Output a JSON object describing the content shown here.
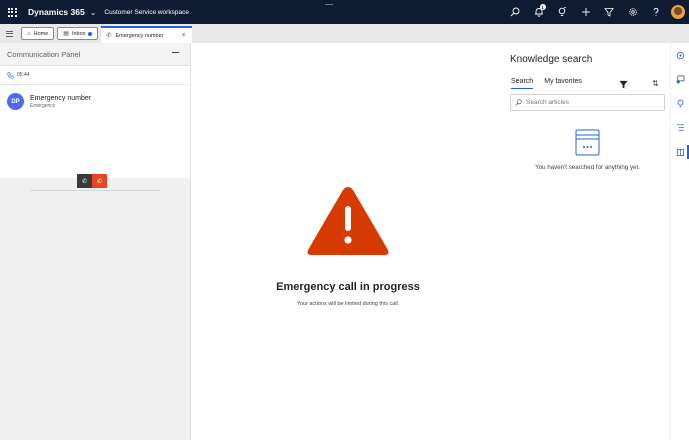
{
  "topbar": {
    "brand": "Dynamics 365",
    "workspace": "Customer Service workspace",
    "notification_count": "1",
    "icons": [
      "search-icon",
      "bell-icon",
      "lightbulb-icon",
      "plus-icon",
      "filter-icon",
      "gear-icon",
      "help-icon",
      "avatar"
    ]
  },
  "tabs": [
    {
      "label": "Home",
      "icon": "home-icon"
    },
    {
      "label": "Inbox",
      "icon": "inbox-icon"
    },
    {
      "label": "Emergency number",
      "icon": "phone-icon",
      "active": true
    }
  ],
  "comm_panel": {
    "title": "Communication Panel",
    "timer": "05:44",
    "caller_initials": "DP",
    "caller_name": "Emergency number",
    "caller_subtitle": "Emergency"
  },
  "main": {
    "title": "Emergency call in progress",
    "subtitle": "Your actions will be limited during this call."
  },
  "knowledge": {
    "title": "Knowledge search",
    "tabs": [
      "Search",
      "My favorites"
    ],
    "search_placeholder": "Search articles",
    "empty_text": "You haven't searched for anything yet."
  },
  "colors": {
    "topbar": "#0f1b33",
    "accent": "#2564cf",
    "warning": "#d83b01",
    "end_call": "#e5461e",
    "avatar": "#4f6bed"
  }
}
